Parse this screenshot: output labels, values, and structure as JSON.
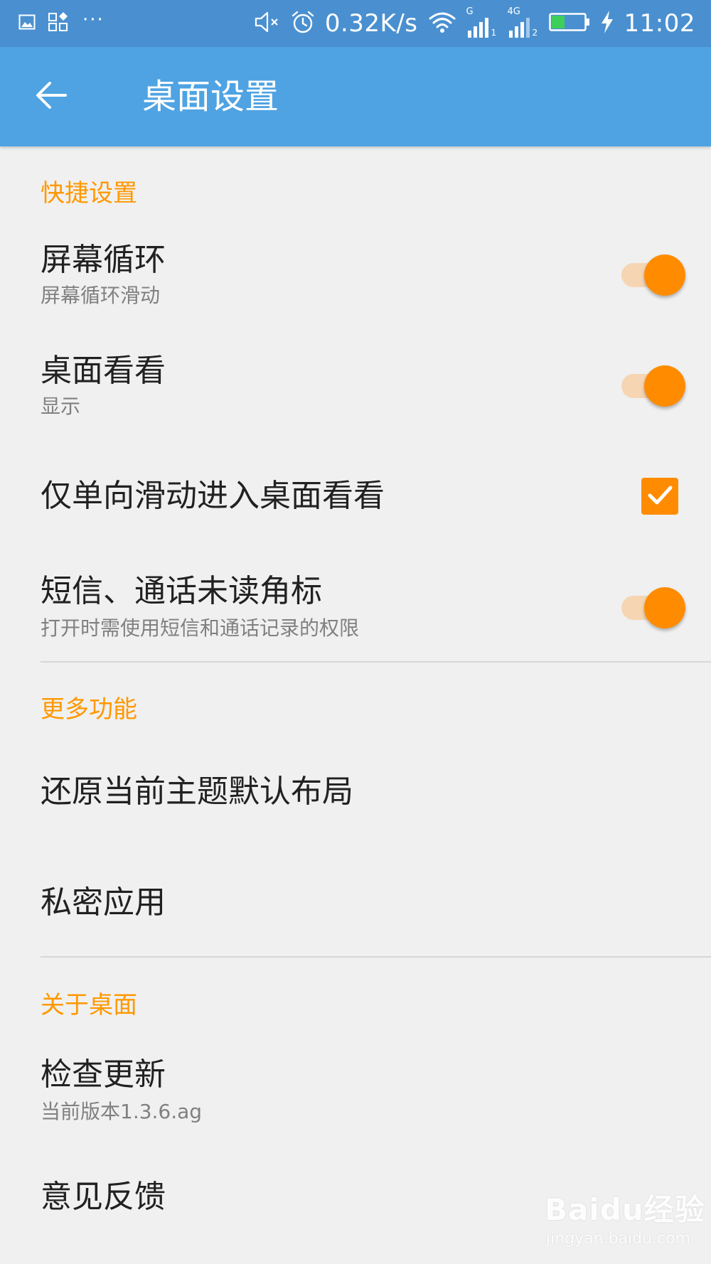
{
  "status_bar": {
    "net_speed": "0.32K/s",
    "time": "11:02",
    "overflow": "···",
    "sim1_network": "G",
    "sim1_index": "1",
    "sim2_network": "4G",
    "sim2_index": "2",
    "battery_level": 0.4,
    "icons": [
      "gallery-icon",
      "apps-icon",
      "mute-icon",
      "alarm-icon",
      "wifi-icon",
      "signal-icon",
      "battery-icon",
      "charging-icon"
    ]
  },
  "toolbar": {
    "title": "桌面设置"
  },
  "sections": {
    "quick": {
      "header": "快捷设置",
      "screen_loop": {
        "title": "屏幕循环",
        "subtitle": "屏幕循环滑动",
        "enabled": true
      },
      "desktop_view": {
        "title": "桌面看看",
        "subtitle": "显示",
        "enabled": true
      },
      "one_way_swipe": {
        "title": "仅单向滑动进入桌面看看",
        "checked": true
      },
      "unread_badge": {
        "title": "短信、通话未读角标",
        "subtitle": "打开时需使用短信和通话记录的权限",
        "enabled": true
      }
    },
    "more": {
      "header": "更多功能",
      "restore_layout": {
        "title": "还原当前主题默认布局"
      },
      "private_apps": {
        "title": "私密应用"
      }
    },
    "about": {
      "header": "关于桌面",
      "check_update": {
        "title": "检查更新",
        "subtitle": "当前版本1.3.6.ag"
      },
      "feedback": {
        "title": "意见反馈"
      }
    }
  },
  "watermark": {
    "logo_text": "Baidu经验",
    "url": "jingyan.baidu.com"
  },
  "colors": {
    "status_bar": "#4a90d0",
    "toolbar": "#4fa3e2",
    "accent": "#ff9800",
    "background": "#f0f0f0",
    "switch_track": "#f6d5b3",
    "switch_thumb": "#ff8c00"
  }
}
